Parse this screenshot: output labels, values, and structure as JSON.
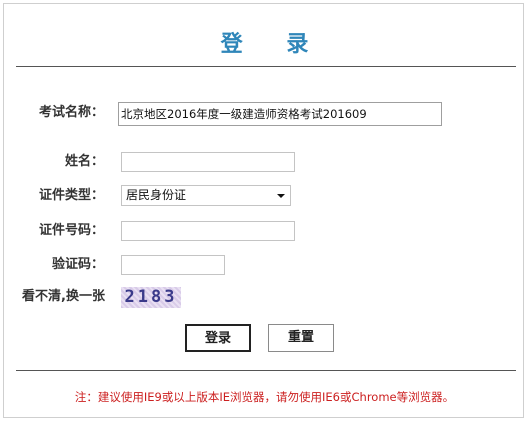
{
  "title": "登  录",
  "form": {
    "exam_name": {
      "label": "考试名称：",
      "value": "北京地区2016年度一级建造师资格考试201609"
    },
    "name": {
      "label": "姓名：",
      "value": ""
    },
    "id_type": {
      "label": "证件类型：",
      "selected": "居民身份证"
    },
    "id_number": {
      "label": "证件号码：",
      "value": ""
    },
    "verify_code": {
      "label": "验证码：",
      "value": ""
    },
    "captcha": {
      "refresh_text": "看不清,换一张",
      "code": "2183"
    }
  },
  "buttons": {
    "login": "登录",
    "reset": "重置"
  },
  "note": "注：建议使用IE9或以上版本IE浏览器，请勿使用IE6或Chrome等浏览器。",
  "colors": {
    "title": "#2f86b9",
    "note": "#cc2020"
  }
}
